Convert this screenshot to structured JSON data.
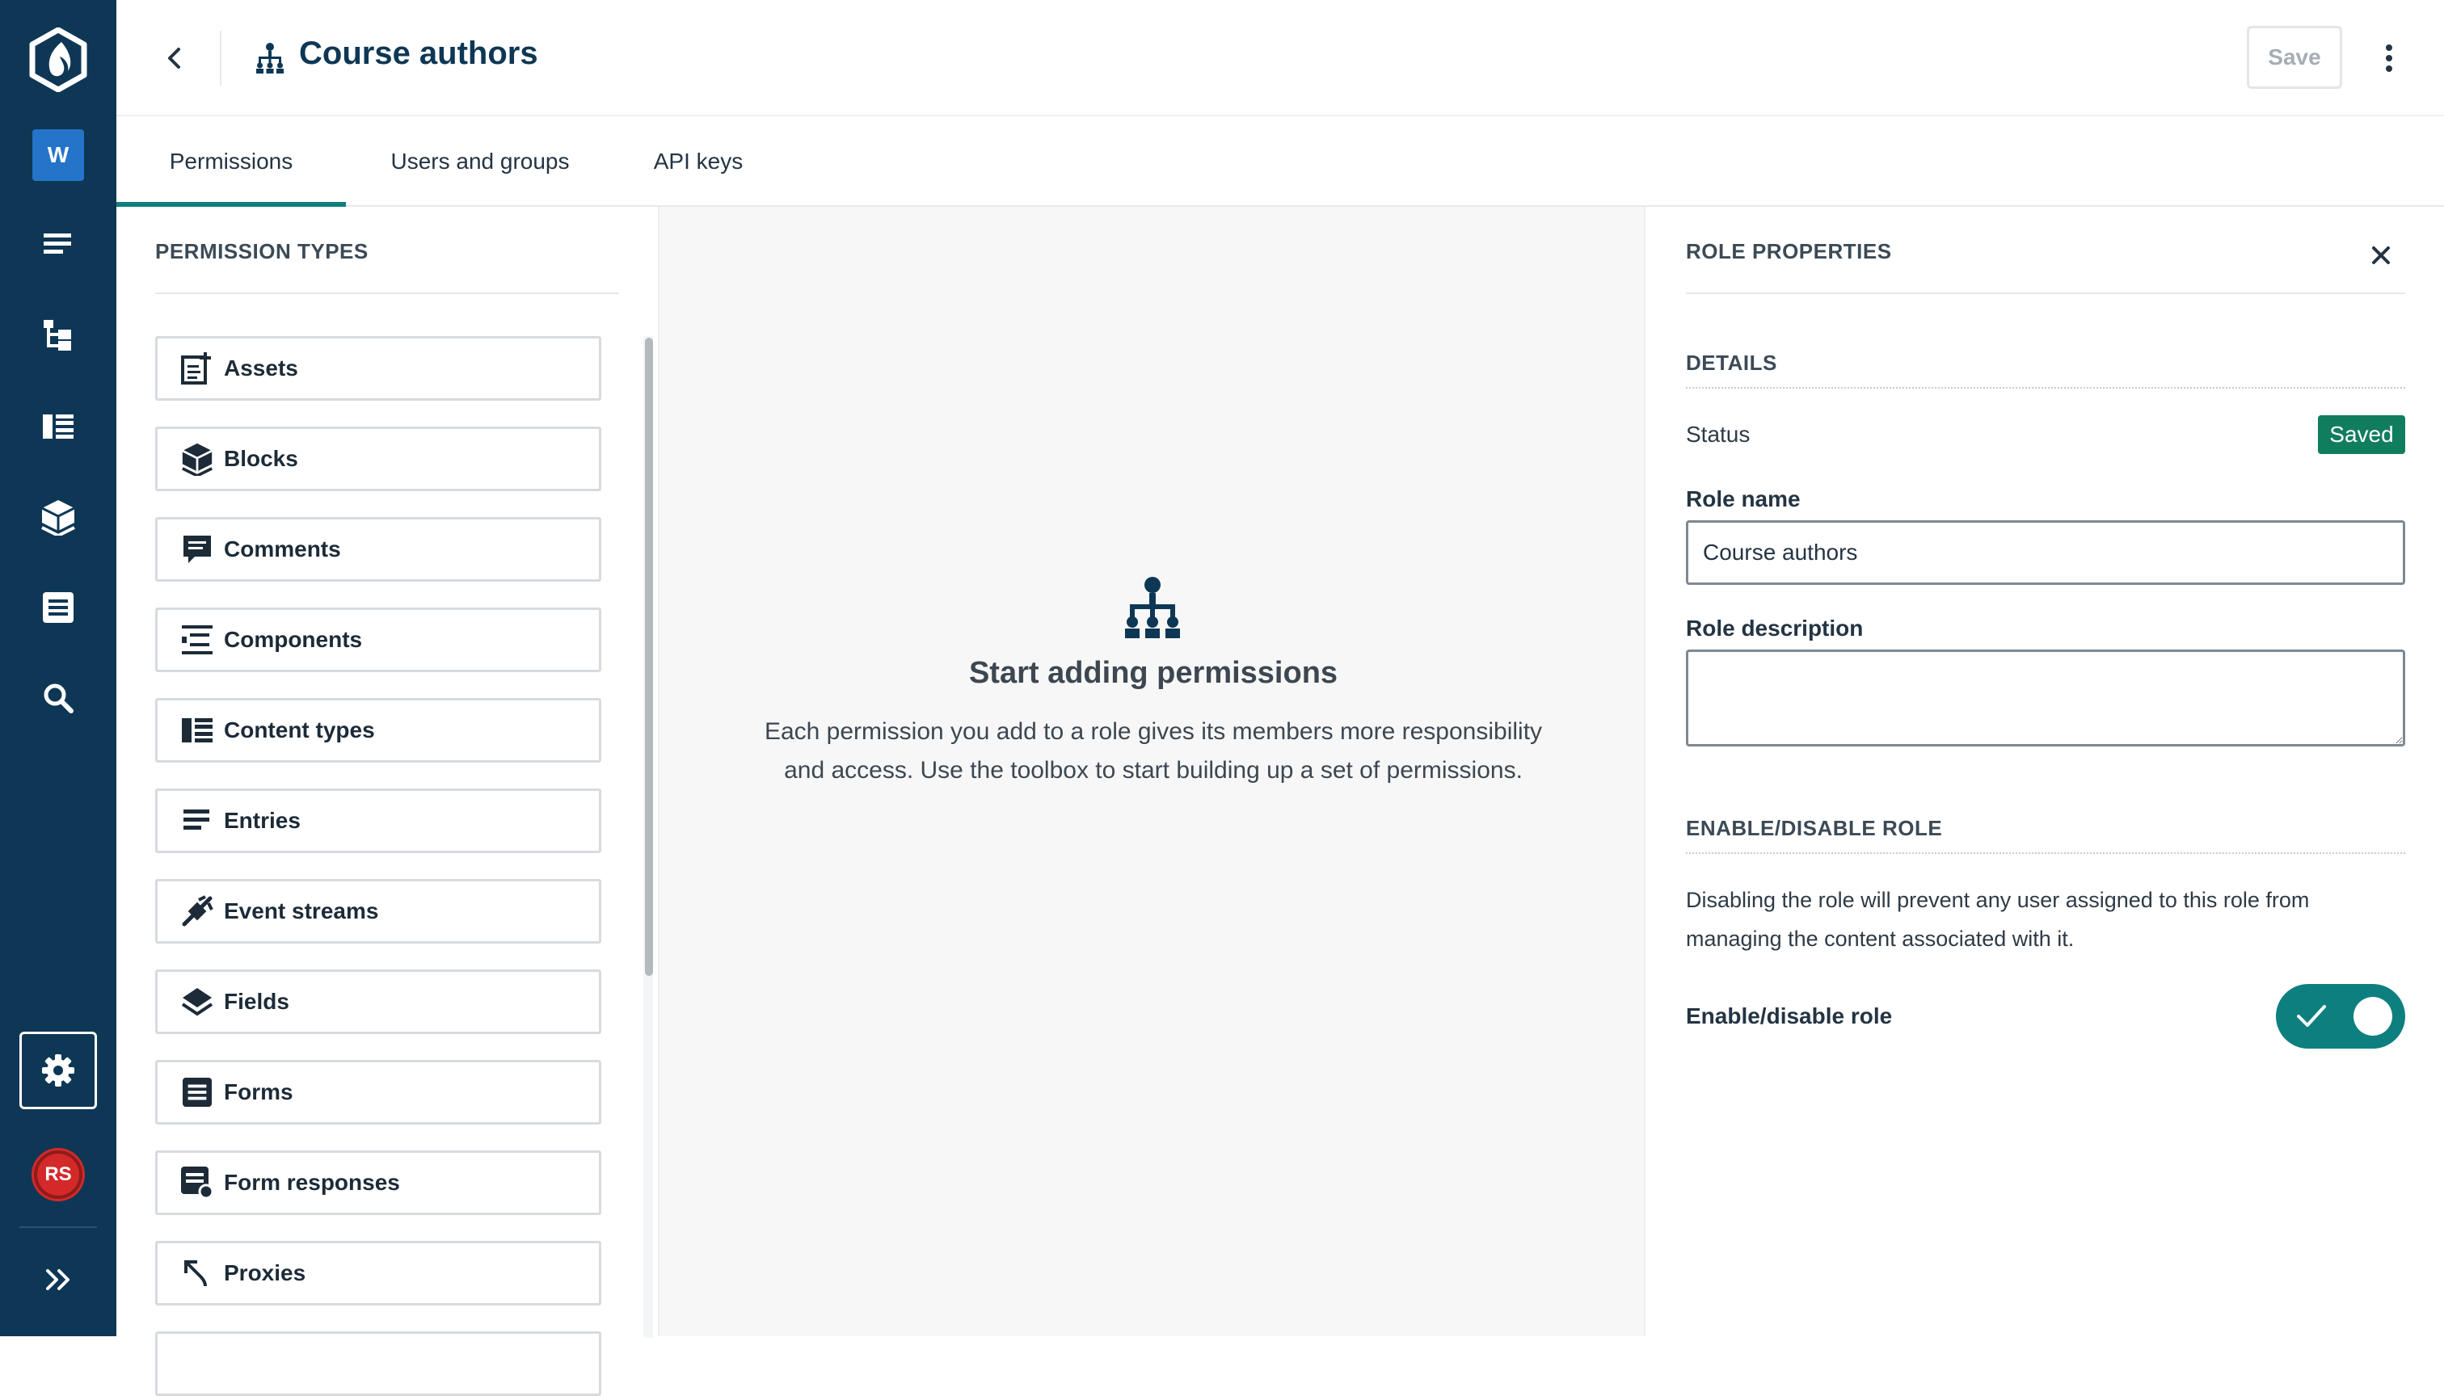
{
  "rail": {
    "space_initial": "W",
    "avatar_initials": "RS",
    "items": [
      "entries-icon",
      "content-tree-icon",
      "content-types-icon",
      "blocks-icon",
      "forms-icon",
      "search-icon",
      "settings-icon"
    ],
    "bg_color": "#0e3755"
  },
  "header": {
    "title": "Course authors",
    "save_label": "Save"
  },
  "tabs": [
    {
      "label": "Permissions",
      "active": true
    },
    {
      "label": "Users and groups",
      "active": false
    },
    {
      "label": "API keys",
      "active": false
    }
  ],
  "permission_types": {
    "heading": "PERMISSION TYPES",
    "items": [
      {
        "label": "Assets",
        "icon": "assets-icon"
      },
      {
        "label": "Blocks",
        "icon": "blocks-icon"
      },
      {
        "label": "Comments",
        "icon": "comments-icon"
      },
      {
        "label": "Components",
        "icon": "components-icon"
      },
      {
        "label": "Content types",
        "icon": "content-types-icon"
      },
      {
        "label": "Entries",
        "icon": "entries-icon"
      },
      {
        "label": "Event streams",
        "icon": "event-streams-icon"
      },
      {
        "label": "Fields",
        "icon": "fields-icon"
      },
      {
        "label": "Forms",
        "icon": "forms-icon"
      },
      {
        "label": "Form responses",
        "icon": "form-responses-icon"
      },
      {
        "label": "Proxies",
        "icon": "proxies-icon"
      }
    ]
  },
  "empty_state": {
    "title": "Start adding permissions",
    "body": "Each permission you add to a role gives its members more responsibility and access. Use the toolbox to start building up a set of permissions."
  },
  "role_properties": {
    "heading": "ROLE PROPERTIES",
    "details_heading": "DETAILS",
    "status_label": "Status",
    "status_value": "Saved",
    "role_name_label": "Role name",
    "role_name_value": "Course authors",
    "role_description_label": "Role description",
    "role_description_value": "",
    "enable_heading": "ENABLE/DISABLE ROLE",
    "enable_description": "Disabling the role will prevent any user assigned to this role from managing the content associated with it.",
    "enable_toggle_label": "Enable/disable role",
    "enabled": true
  },
  "colors": {
    "accent": "#0d7f7f",
    "status_saved": "#117d5f",
    "title": "#0e3755"
  }
}
